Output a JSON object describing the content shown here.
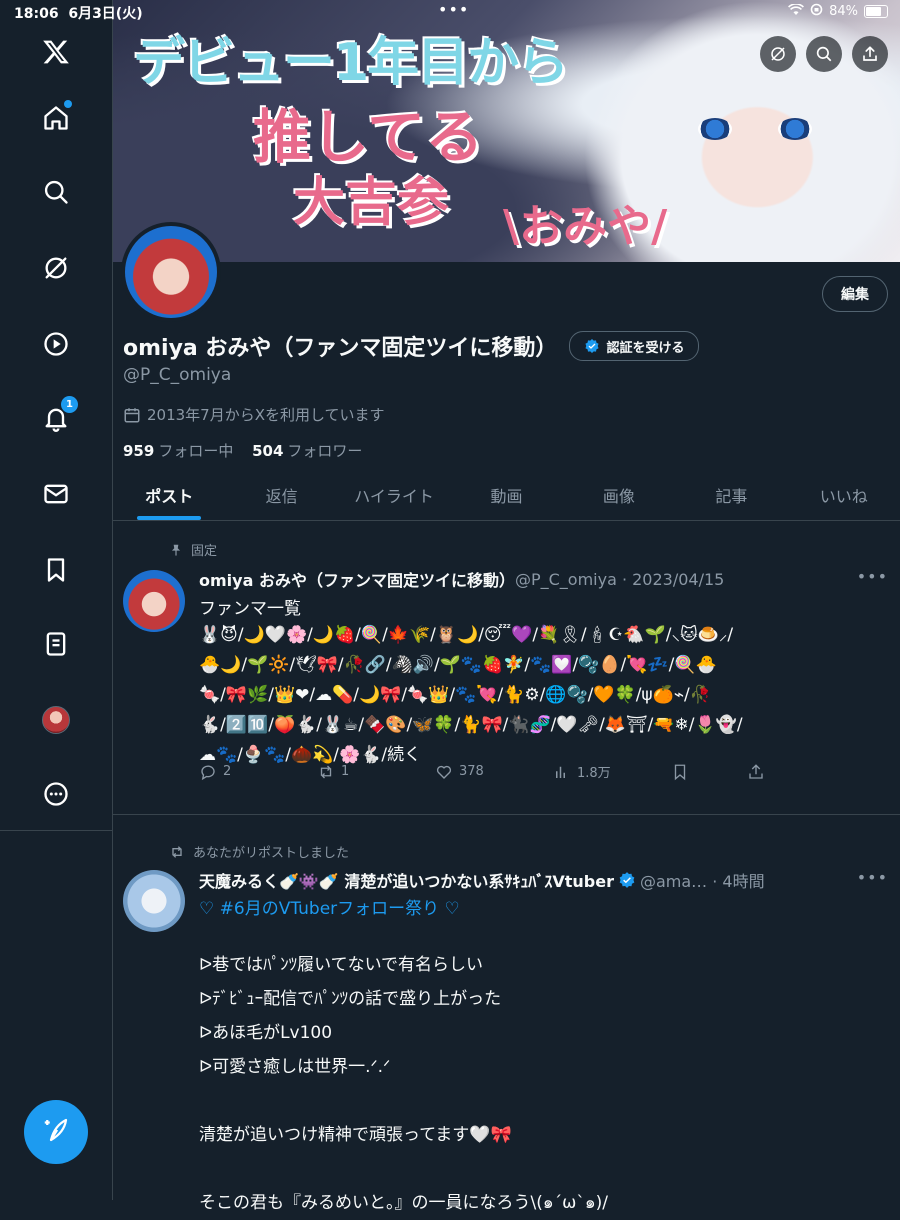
{
  "status": {
    "time": "18:06",
    "date": "6月3日(火)",
    "battery": "84%"
  },
  "sidebar": {
    "items": [
      {
        "name": "x-logo"
      },
      {
        "name": "home"
      },
      {
        "name": "explore"
      },
      {
        "name": "grok"
      },
      {
        "name": "video"
      },
      {
        "name": "notifications",
        "badge": "1"
      },
      {
        "name": "messages"
      },
      {
        "name": "bookmarks"
      },
      {
        "name": "lists"
      },
      {
        "name": "profile"
      },
      {
        "name": "more"
      }
    ]
  },
  "banner": {
    "line1": "デビュー1年目から",
    "line2": "推してる",
    "line3": "大吉参",
    "line4": "\\おみや/"
  },
  "profile": {
    "name": "omiya おみや（ファンマ固定ツイに移動）",
    "verify_label": "認証を受ける",
    "edit_label": "編集",
    "handle": "@P_C_omiya",
    "joined": "2013年7月からXを利用しています",
    "following_count": "959",
    "following_label": "フォロー中",
    "followers_count": "504",
    "followers_label": "フォロワー"
  },
  "tabs": [
    "ポスト",
    "返信",
    "ハイライト",
    "動画",
    "画像",
    "記事",
    "いいね"
  ],
  "posts": [
    {
      "context": "固定",
      "name": "omiya おみや（ファンマ固定ツイに移動）",
      "meta": "@P_C_omiya · 2023/04/15",
      "title": "ファンマ一覧",
      "emoji_lines": [
        "🐰😈/🌙🤍🌸/🌙🍓/🍭/🍁🌾/🦉🌙/😴💜/💐🎗/🕯☪🐔🌱/⸜🐱🍮⸝/",
        "🐣🌙/🌱🔆/🕊🎀/🥀🔗/🦓🔊/🌱🐾🍓🧚/🐾💟/🫧🥚/💘💤/🍭🐣",
        "🍬/🎀🌿/👑❤/☁💊/🌙🎀/🍬👑/🐾💘/🐈⚙/🌐🫧/🧡🍀/ψ🍊⌁/🥀",
        "🐇/2️⃣🔟/🍑🐇/🐰☕/🍫🎨/🦋🍀/🐈🎀/🐈‍⬛🧬/🤍🗝/🦊⛩/🔫❄/🌷👻/",
        "☁🐾/🍨🐾/🌰💫/🌸🐇/続く"
      ],
      "stats": {
        "replies": "2",
        "reposts": "1",
        "likes": "378",
        "views": "1.8万"
      }
    },
    {
      "context": "あなたがリポストしました",
      "name": "天魔みるく🍼👾🍼 清楚が追いつかない系ｻｷｭﾊﾞｽVtuber",
      "meta": "@ama… · 4時間",
      "hashtag_line": "♡ #6月のVTuberフォロー祭り ♡",
      "body": "ᐅ巷ではﾊﾟﾝﾂ履いてないで有名らしい\nᐅﾃﾞﾋﾞｭｰ配信でﾊﾟﾝﾂの話で盛り上がった\nᐅあほ毛がLv100\nᐅ可愛さ癒しは世界一.ᐟ.ᐟ\n\n清楚が追いつけ精神で頑張ってます🤍🎀\n\nそこの君も『みるめいと。』の一員になろう\\(๑´ω`๑)/"
    }
  ],
  "colors": {
    "background": "#15202b",
    "accent": "#1d9bf0",
    "muted": "#8b98a5",
    "border": "#38444d"
  }
}
